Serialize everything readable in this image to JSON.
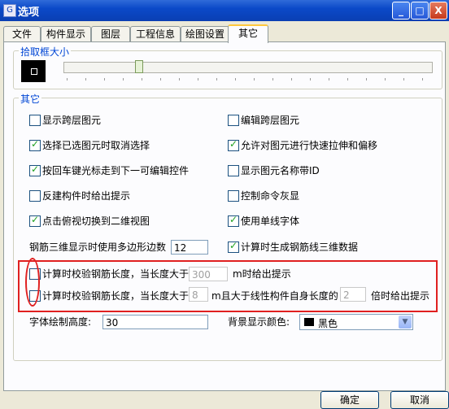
{
  "window": {
    "title": "选项",
    "minimize": "_",
    "maximize": "□",
    "close": "X"
  },
  "tabs": [
    "文件",
    "构件显示",
    "图层",
    "工程信息",
    "绘图设置",
    "其它"
  ],
  "pick_group": {
    "legend": "拾取框大小"
  },
  "other_group": {
    "legend": "其它"
  },
  "options": {
    "show_cross_layer": {
      "label": "显示跨层图元",
      "checked": false
    },
    "edit_cross_layer": {
      "label": "编辑跨层图元",
      "checked": false
    },
    "deselect_on_select": {
      "label": "选择已选图元时取消选择",
      "checked": true
    },
    "quick_stretch": {
      "label": "允许对图元进行快速拉伸和偏移",
      "checked": true
    },
    "enter_next_control": {
      "label": "按回车键光标走到下一可编辑控件",
      "checked": true
    },
    "show_name_id": {
      "label": "显示图元名称带ID",
      "checked": false
    },
    "reverse_hint": {
      "label": "反建构件时给出提示",
      "checked": false
    },
    "cmd_gray": {
      "label": "控制命令灰显",
      "checked": false
    },
    "click_2d": {
      "label": "点击俯视切换到二维视图",
      "checked": true
    },
    "single_line_font": {
      "label": "使用单线字体",
      "checked": true
    },
    "polygon_edges": {
      "label": "钢筋三维显示时使用多边形边数",
      "value": "12"
    },
    "gen_rebar_3d": {
      "label": "计算时生成钢筋线三维数据",
      "checked": true
    },
    "check_length": {
      "label": "计算时校验钢筋长度，当长度大于",
      "value": "300",
      "suffix": "m时给出提示",
      "checked": false
    },
    "check_length_ratio": {
      "label": "计算时校验钢筋长度，当长度大于",
      "value": "8",
      "mid": "m且大于线性构件自身长度的",
      "ratio": "2",
      "suffix": "倍时给出提示",
      "checked": false
    },
    "font_height": {
      "label": "字体绘制高度:",
      "value": "30"
    },
    "bg_color": {
      "label": "背景显示颜色:",
      "value": "黑色",
      "color": "#000000"
    }
  },
  "buttons": {
    "ok": "确定",
    "cancel": "取消"
  }
}
